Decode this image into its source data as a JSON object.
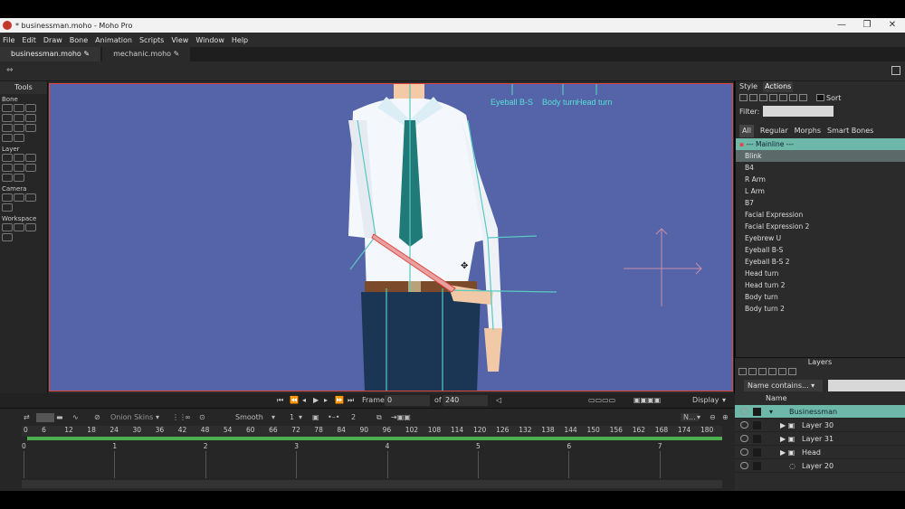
{
  "window": {
    "title": "* businessman.moho - Moho Pro",
    "controls": [
      "—",
      "❐",
      "✕"
    ]
  },
  "menu": [
    "File",
    "Edit",
    "Draw",
    "Bone",
    "Animation",
    "Scripts",
    "View",
    "Window",
    "Help"
  ],
  "tabs": [
    {
      "label": "businessman.moho",
      "active": true
    },
    {
      "label": "mechanic.moho",
      "active": false
    }
  ],
  "tools": {
    "title": "Tools",
    "sections": {
      "bone": "Bone",
      "layer": "Layer",
      "camera": "Camera",
      "workspace": "Workspace"
    }
  },
  "canvas": {
    "background": "#5563a8",
    "border": "#e0463f",
    "bone_labels": [
      "Eyeball B-S",
      "Body turn",
      "Head turn"
    ]
  },
  "right_panel": {
    "tabs": [
      "Style",
      "Actions"
    ],
    "sort_label": "Sort",
    "filter_label": "Filter:",
    "subtabs": [
      "All",
      "Regular",
      "Morphs",
      "Smart Bones"
    ],
    "actions": [
      "--- Mainline ---",
      "Blink",
      "B4",
      "R Arm",
      "L Arm",
      "B7",
      "Facial Expression",
      "Facial Expression 2",
      "Eyebrew U",
      "Eyeball B-S",
      "Eyeball B-S 2",
      "Head turn",
      "Head turn 2",
      "Body turn",
      "Body turn 2"
    ],
    "mainline_color": "#6db8a8"
  },
  "playback": {
    "frame_label": "Frame",
    "frame_value": "0",
    "of_label": "of",
    "total_frames": "240",
    "display_label": "Display"
  },
  "timeline": {
    "onion_skins": "Onion Skins",
    "interpolation": "Smooth",
    "step": "1",
    "keys": "2",
    "mode": "N...",
    "frame_ticks": [
      "0",
      "6",
      "12",
      "18",
      "24",
      "30",
      "36",
      "42",
      "48",
      "54",
      "60",
      "66",
      "72",
      "78",
      "84",
      "90",
      "96",
      "102",
      "108",
      "114",
      "120",
      "126",
      "132",
      "138",
      "144",
      "150",
      "156",
      "162",
      "168",
      "174",
      "180"
    ],
    "second_ticks": [
      "0",
      "1",
      "2",
      "3",
      "4",
      "5",
      "6",
      "7"
    ],
    "bar_color": "#4caf50"
  },
  "layers": {
    "title": "Layers",
    "name_filter": "Name contains...",
    "column": "Name",
    "rows": [
      {
        "name": "Businessman",
        "selected": true
      },
      {
        "name": "Layer 30",
        "selected": false
      },
      {
        "name": "Layer 31",
        "selected": false
      },
      {
        "name": "Head",
        "selected": false
      },
      {
        "name": "Layer 20",
        "selected": false
      }
    ],
    "selected_color": "#6db8a8"
  }
}
